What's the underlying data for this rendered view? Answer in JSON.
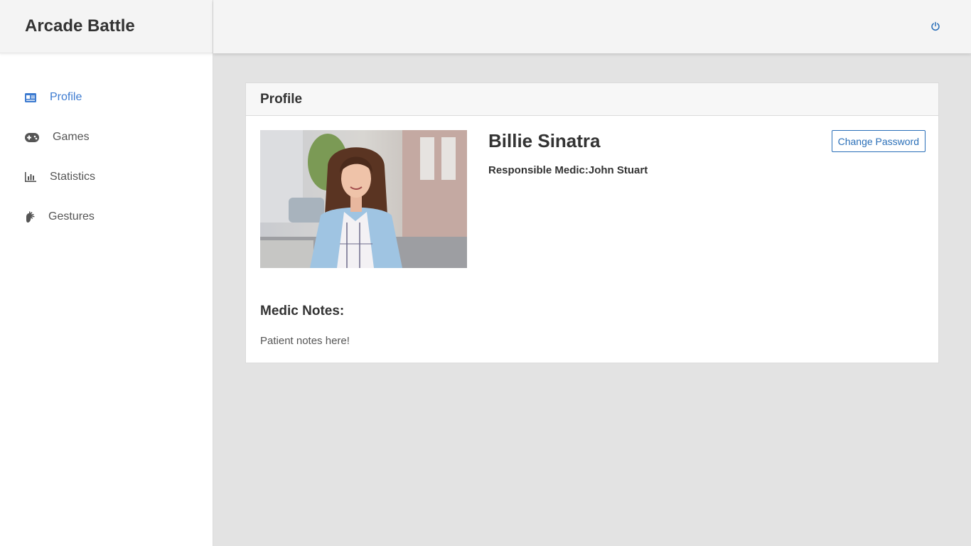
{
  "app": {
    "title": "Arcade Battle"
  },
  "sidebar": {
    "items": [
      {
        "label": "Profile",
        "icon": "id-card-icon",
        "active": true
      },
      {
        "label": "Games",
        "icon": "gamepad-icon",
        "active": false
      },
      {
        "label": "Statistics",
        "icon": "bar-chart-icon",
        "active": false
      },
      {
        "label": "Gestures",
        "icon": "hand-icon",
        "active": false
      }
    ]
  },
  "topbar": {
    "power_icon": "power-icon"
  },
  "profile": {
    "card_title": "Profile",
    "name": "Billie Sinatra",
    "responsible_medic": "Responsible Medic:John Stuart",
    "change_password_label": "Change Password",
    "notes_title": "Medic Notes:",
    "notes_text": "Patient notes here!"
  },
  "colors": {
    "accent": "#3d7bd0",
    "button": "#2a6fb8"
  }
}
